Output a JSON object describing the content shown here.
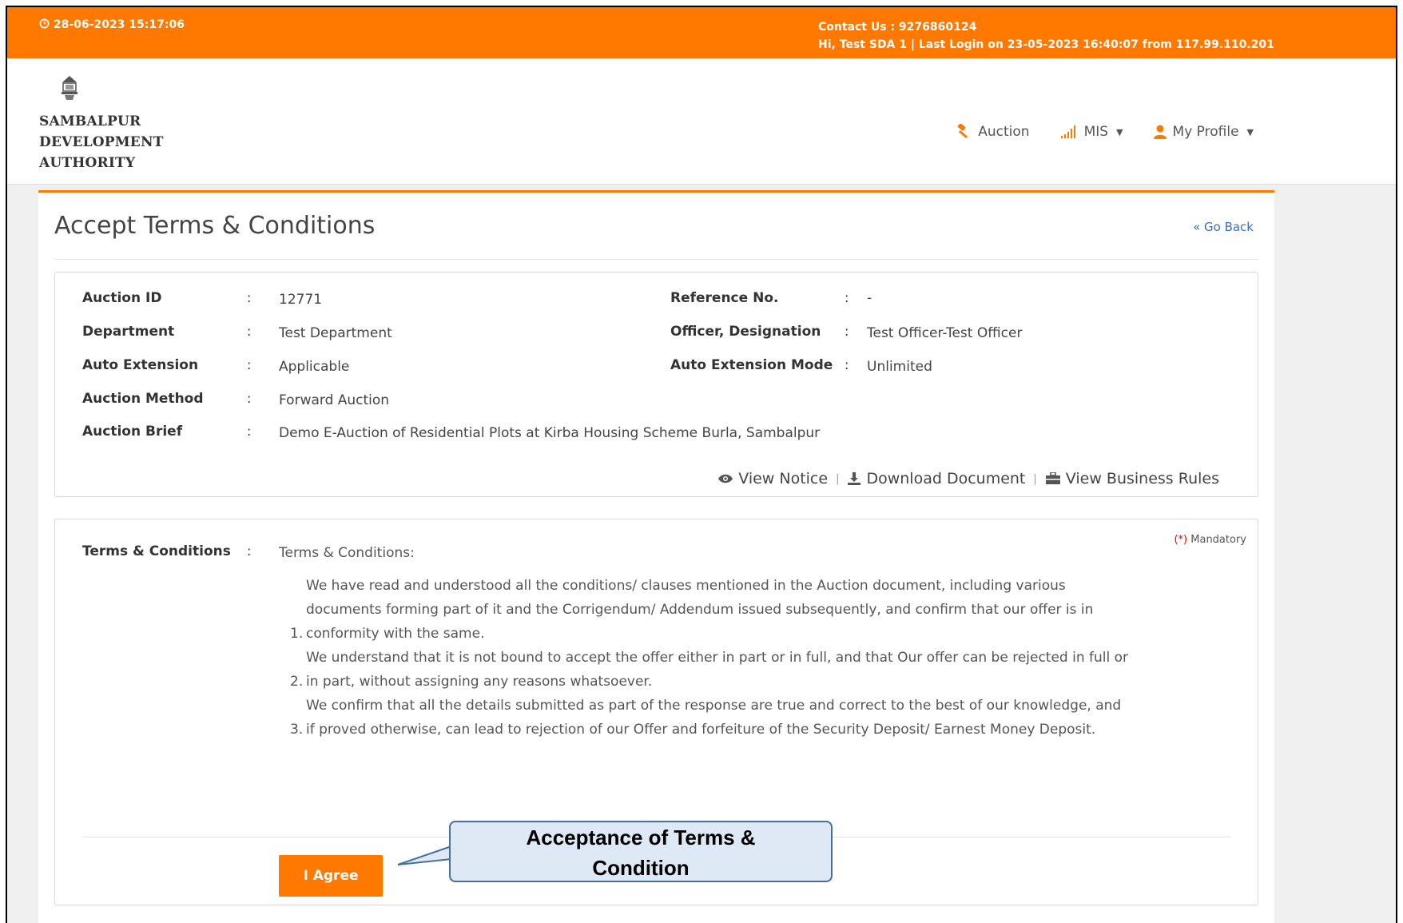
{
  "topbar": {
    "datetime": "28-06-2023 15:17:06",
    "contact": "Contact Us : 9276860124",
    "login_info": "Hi, Test SDA 1 | Last Login on 23-05-2023 16:40:07 from 117.99.110.201"
  },
  "header": {
    "logo_line1": "SAMBALPUR",
    "logo_line2": "DEVELOPMENT",
    "logo_line3": "AUTHORITY",
    "nav": {
      "auction": "Auction",
      "mis": "MIS",
      "profile": "My Profile"
    }
  },
  "page": {
    "title": "Accept Terms & Conditions",
    "go_back": "« Go Back"
  },
  "info": {
    "auction_id_label": "Auction ID",
    "auction_id": "12771",
    "reference_label": "Reference No.",
    "reference": "-",
    "department_label": "Department",
    "department": "Test Department",
    "officer_label": "Officer, Designation",
    "officer": "Test Officer-Test Officer",
    "auto_ext_label": "Auto Extension",
    "auto_ext": "Applicable",
    "auto_ext_mode_label": "Auto Extension Mode",
    "auto_ext_mode": "Unlimited",
    "method_label": "Auction Method",
    "method": "Forward Auction",
    "brief_label": "Auction Brief",
    "brief": "Demo E-Auction of Residential Plots at Kirba Housing Scheme Burla, Sambalpur",
    "colon": ":"
  },
  "links": {
    "view_notice": "View Notice",
    "download": "Download Document",
    "business_rules": "View Business Rules"
  },
  "terms": {
    "mandatory_star": "(*)",
    "mandatory": " Mandatory",
    "label": "Terms & Conditions",
    "intro": "Terms & Conditions:",
    "clauses": [
      {
        "num": "1.",
        "text": "We have read and understood all the conditions/ clauses mentioned in the Auction document, including various documents forming part of it and the Corrigendum/ Addendum issued subsequently, and confirm that our offer is in conformity with the same."
      },
      {
        "num": "2.",
        "text": "We understand that it is not bound to accept the offer either in part or in full, and that Our offer can be rejected in full or in part, without assigning any reasons whatsoever."
      },
      {
        "num": "3.",
        "text": "We confirm that all the details submitted as part of the response are true and correct to the best of our knowledge, and if proved otherwise, can lead to rejection of our Offer and forfeiture of the Security Deposit/ Earnest Money Deposit."
      }
    ],
    "agree_button": "I Agree"
  },
  "callout": {
    "line1": "Acceptance of Terms &",
    "line2": "Condition"
  },
  "colors": {
    "accent": "#ff7800",
    "link": "#3b6fb6",
    "callout_fill": "#dfe9f6",
    "callout_border": "#41719c"
  },
  "icons": [
    "clock-icon",
    "gavel-icon",
    "signal-bars-icon",
    "user-icon",
    "eye-icon",
    "download-icon",
    "briefcase-icon",
    "emblem-icon"
  ]
}
